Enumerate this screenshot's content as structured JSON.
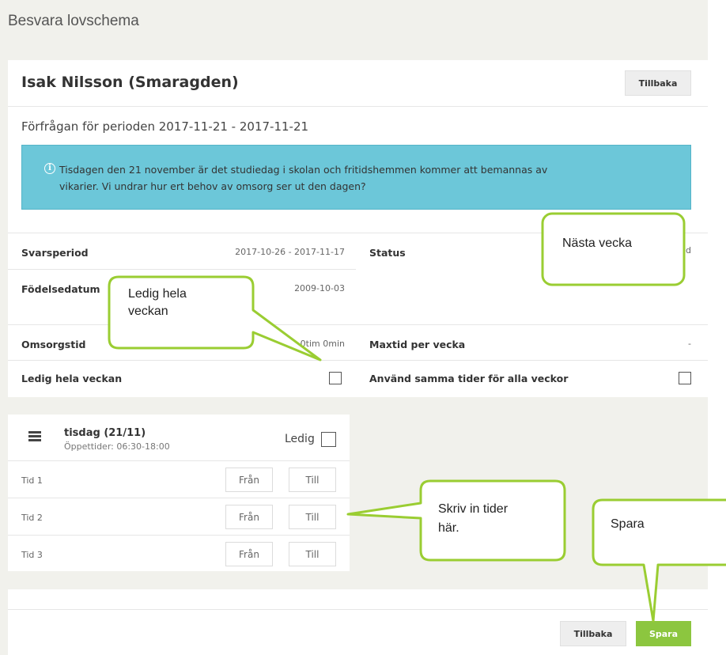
{
  "page": {
    "title": "Besvara lovschema"
  },
  "header": {
    "name": "Isak Nilsson (Smaragden)",
    "back_label": "Tillbaka"
  },
  "period": {
    "text": "Förfrågan för perioden 2017-11-21 - 2017-11-21"
  },
  "alert": {
    "icon": "info-icon",
    "line1": "Tisdagen den 21 november är det studiedag i skolan och fritidshemmen kommer att bemannas av",
    "line2": "vikarier. Vi undrar hur ert behov av omsorg ser ut den dagen?"
  },
  "details": {
    "svarsperiod_label": "Svarsperiod",
    "svarsperiod_value": "2017-10-26 - 2017-11-17",
    "status_label": "Status",
    "status_value_fragment": "d",
    "fodelsedatum_label": "Födelsedatum",
    "fodelsedatum_value": "2009-10-03",
    "omsorgstid_label": "Omsorgstid",
    "omsorgstid_value": "0tim 0min",
    "maxtid_label": "Maxtid per vecka",
    "maxtid_value": "-",
    "ledig_veckan_label": "Ledig hela veckan",
    "samma_tider_label": "Använd samma tider för alla veckor"
  },
  "day": {
    "title": "tisdag (21/11)",
    "hours": "Öppettider: 06:30-18:00",
    "ledig_label": "Ledig",
    "rows": [
      {
        "label": "Tid 1",
        "from": "Från",
        "to": "Till"
      },
      {
        "label": "Tid 2",
        "from": "Från",
        "to": "Till"
      },
      {
        "label": "Tid 3",
        "from": "Från",
        "to": "Till"
      }
    ]
  },
  "footer": {
    "back_label": "Tillbaka",
    "save_label": "Spara"
  },
  "callouts": {
    "nasta_vecka": "Nästa vecka",
    "ledig_line1": "Ledig hela",
    "ledig_line2": "veckan",
    "skriv_line1": "Skriv in tider",
    "skriv_line2": "här.",
    "spara": "Spara"
  },
  "colors": {
    "accent_green": "#8cc63f",
    "alert_blue": "#6cc7d9",
    "callout_border": "#9acd32",
    "page_bg": "#f1f1ec"
  }
}
